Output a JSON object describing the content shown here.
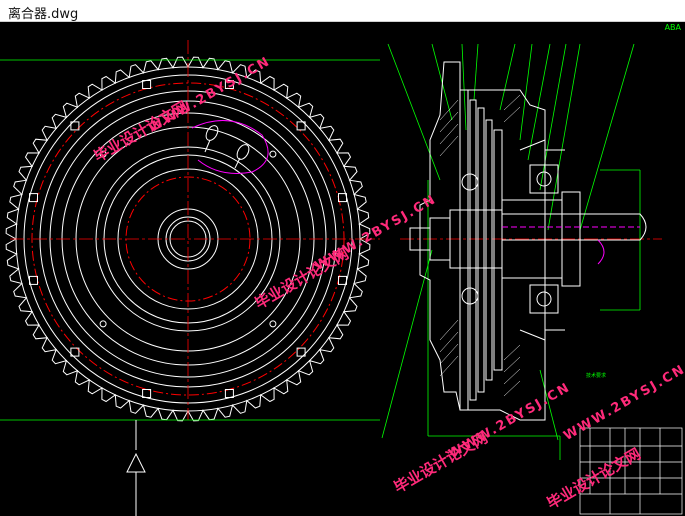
{
  "window": {
    "title": "离合器.dwg"
  },
  "drawing": {
    "corner_label": "ABA",
    "tech_notes_title": "技术要求",
    "watermarks": [
      {
        "url": "WWW.2BYSJ.CN",
        "cn": "毕业设计论文网"
      },
      {
        "url": "WWW.2BYSJ.CN",
        "cn": "毕业设计论文网"
      },
      {
        "url": "WWW.2BYSJ.CN",
        "cn": "毕业设计论文网"
      },
      {
        "url": "WWW.2BYSJ.CN",
        "cn": "毕业设计论文网"
      }
    ],
    "colors": {
      "background": "#000000",
      "geometry": "#ffffff",
      "centerline": "#ff0000",
      "annotation": "#00ff00",
      "highlight": "#ff00ff",
      "watermark": "#ff2a7a"
    }
  }
}
